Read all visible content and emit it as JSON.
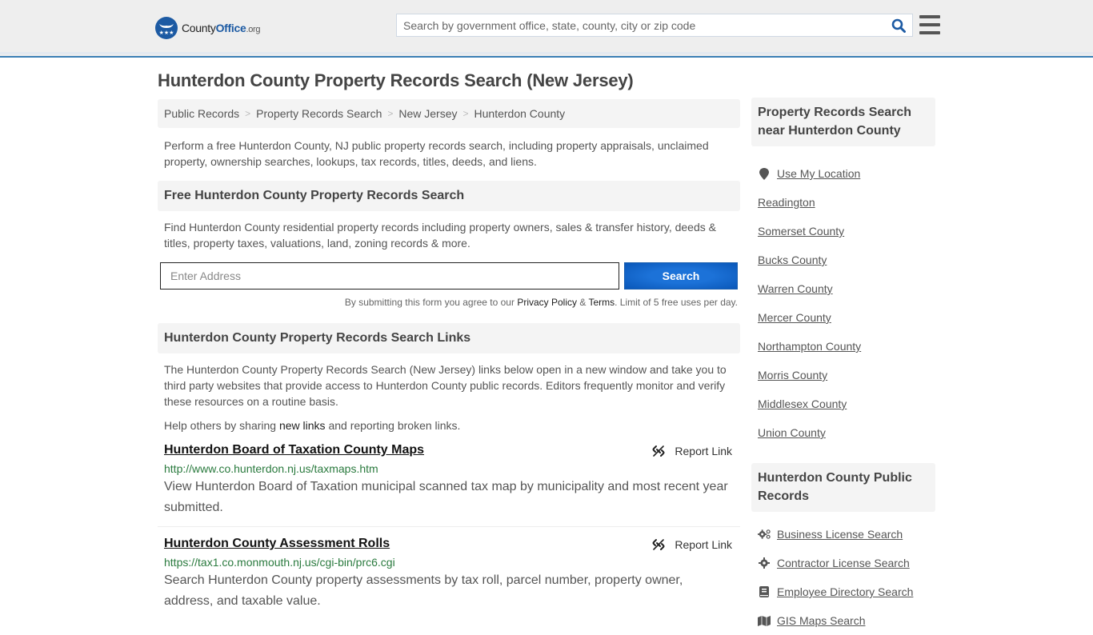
{
  "header": {
    "logo": {
      "brand_left": "County",
      "brand_right": "Office",
      "brand_tld": ".org"
    },
    "search": {
      "placeholder": "Search by government office, state, county, city or zip code"
    },
    "icons": {
      "search": "search-icon",
      "menu": "hamburger-menu-icon"
    }
  },
  "page": {
    "title": "Hunterdon County Property Records Search (New Jersey)",
    "breadcrumb": [
      "Public Records",
      "Property Records Search",
      "New Jersey",
      "Hunterdon County"
    ],
    "breadcrumb_separator": ">",
    "intro": "Perform a free Hunterdon County, NJ public property records search, including property appraisals, unclaimed property, ownership searches, lookups, tax records, titles, deeds, and liens."
  },
  "free_search": {
    "heading": "Free Hunterdon County Property Records Search",
    "description": "Find Hunterdon County residential property records including property owners, sales & transfer history, deeds & titles, property taxes, valuations, land, zoning records & more.",
    "address_placeholder": "Enter Address",
    "button_label": "Search",
    "disclaimer_prefix": "By submitting this form you agree to our ",
    "privacy_label": "Privacy Policy",
    "amp": " & ",
    "terms_label": "Terms",
    "disclaimer_suffix": ". Limit of 5 free uses per day.",
    "accent_color": "#1467cc"
  },
  "links_section": {
    "heading": "Hunterdon County Property Records Search Links",
    "description": "The Hunterdon County Property Records Search (New Jersey) links below open in a new window and take you to third party websites that provide access to Hunterdon County public records. Editors frequently monitor and verify these resources on a routine basis.",
    "help_prefix": "Help others by sharing ",
    "help_link": "new links",
    "help_suffix": " and reporting broken links.",
    "report_label": "Report Link",
    "items": [
      {
        "title": "Hunterdon Board of Taxation County Maps",
        "url": "http://www.co.hunterdon.nj.us/taxmaps.htm",
        "description": "View Hunterdon Board of Taxation municipal scanned tax map by municipality and most recent year submitted."
      },
      {
        "title": "Hunterdon County Assessment Rolls",
        "url": "https://tax1.co.monmouth.nj.us/cgi-bin/prc6.cgi",
        "description": "Search Hunterdon County property assessments by tax roll, parcel number, property owner, address, and taxable value."
      }
    ],
    "url_color": "#2a7a3e"
  },
  "sidebar": {
    "nearby": {
      "heading": "Property Records Search near Hunterdon County",
      "use_location": "Use My Location",
      "items": [
        "Readington",
        "Somerset County",
        "Bucks County",
        "Warren County",
        "Mercer County",
        "Northampton County",
        "Morris County",
        "Middlesex County",
        "Union County"
      ]
    },
    "public_records": {
      "heading": "Hunterdon County Public Records",
      "items": [
        {
          "label": "Business License Search",
          "icon": "gears-icon"
        },
        {
          "label": "Contractor License Search",
          "icon": "gear-icon"
        },
        {
          "label": "Employee Directory Search",
          "icon": "book-icon"
        },
        {
          "label": "GIS Maps Search",
          "icon": "map-icon"
        }
      ]
    }
  }
}
